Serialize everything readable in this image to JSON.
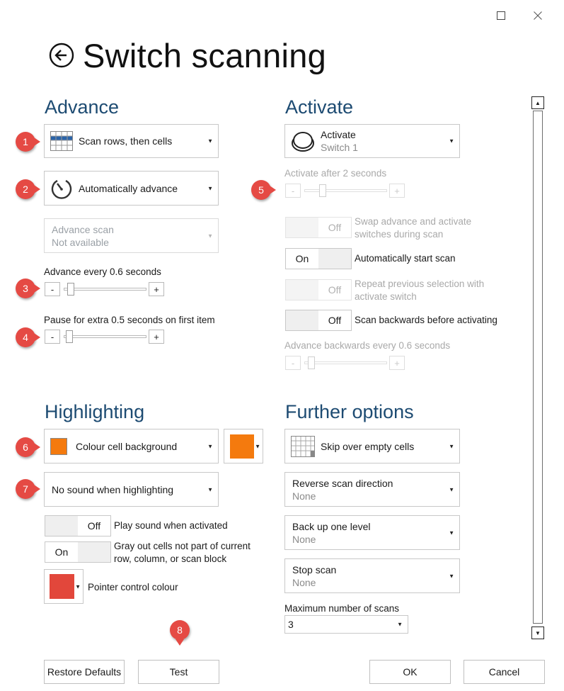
{
  "window": {
    "maximize_icon": "square-icon",
    "close_icon": "close-icon"
  },
  "page": {
    "title": "Switch scanning",
    "back_icon": "back-arrow-icon"
  },
  "advance": {
    "heading": "Advance",
    "scan_mode": "Scan rows, then cells",
    "advance_mode": "Automatically advance",
    "advance_scan_title": "Advance scan",
    "advance_scan_value": "Not available",
    "advance_every_label": "Advance every 0.6 seconds",
    "advance_every_level": 0.05,
    "pause_label": "Pause for extra 0.5 seconds on first item",
    "pause_level": 0.03,
    "minus": "-",
    "plus": "+"
  },
  "activate": {
    "heading": "Activate",
    "switch_title": "Activate",
    "switch_value": "Switch 1",
    "activate_after_label": "Activate after 2 seconds",
    "activate_after_level": 0.2,
    "swap_toggle": "Off",
    "swap_label_line1": "Swap advance and activate",
    "swap_label_line2": "switches during scan",
    "auto_start_toggle": "On",
    "auto_start_label": "Automatically start scan",
    "repeat_toggle": "Off",
    "repeat_label_line1": "Repeat previous selection with",
    "repeat_label_line2": "activate switch",
    "backwards_toggle": "Off",
    "backwards_label": "Scan backwards before activating",
    "advance_backwards_label": "Advance backwards every 0.6 seconds",
    "advance_backwards_level": 0.05
  },
  "highlighting": {
    "heading": "Highlighting",
    "style": "Colour cell background",
    "style_color": "#f47a0e",
    "sound": "No sound when highlighting",
    "play_sound_toggle": "Off",
    "play_sound_label": "Play sound when activated",
    "gray_out_toggle": "On",
    "gray_out_line1": "Gray out cells not part of current",
    "gray_out_line2": "row, column, or scan block",
    "pointer_color": "#e2473b",
    "pointer_label": "Pointer control colour"
  },
  "further": {
    "heading": "Further options",
    "skip": "Skip over empty cells",
    "reverse_title": "Reverse scan direction",
    "reverse_value": "None",
    "backup_title": "Back up one level",
    "backup_value": "None",
    "stop_title": "Stop scan",
    "stop_value": "None",
    "max_scans_label": "Maximum number of scans",
    "max_scans_value": "3"
  },
  "badges": [
    "1",
    "2",
    "3",
    "4",
    "5",
    "6",
    "7",
    "8"
  ],
  "footer": {
    "restore": "Restore Defaults",
    "test": "Test",
    "ok": "OK",
    "cancel": "Cancel"
  }
}
